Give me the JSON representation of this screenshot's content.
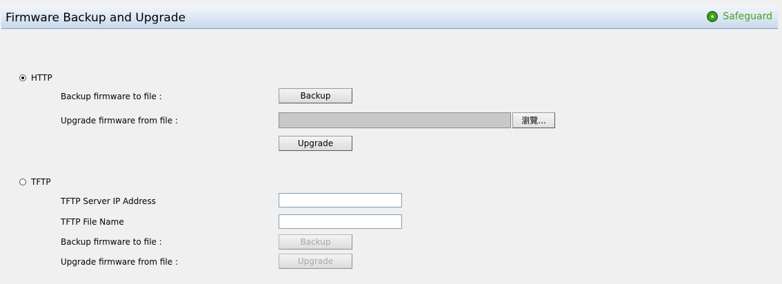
{
  "header": {
    "title": "Firmware Backup and Upgrade",
    "safeguard_label": "Safeguard",
    "safeguard_color": "#4aa31b"
  },
  "http": {
    "radio_label": "HTTP",
    "selected": true,
    "backup_label": "Backup firmware to file :",
    "backup_button": "Backup",
    "upgrade_label": "Upgrade firmware from file :",
    "file_value": "",
    "browse_button": "瀏覽...",
    "upgrade_button": "Upgrade"
  },
  "tftp": {
    "radio_label": "TFTP",
    "selected": false,
    "server_ip_label": "TFTP Server IP Address",
    "server_ip_value": "",
    "file_name_label": "TFTP File Name",
    "file_name_value": "",
    "backup_label": "Backup firmware to file :",
    "backup_button": "Backup",
    "upgrade_label": "Upgrade firmware from file :",
    "upgrade_button": "Upgrade"
  }
}
